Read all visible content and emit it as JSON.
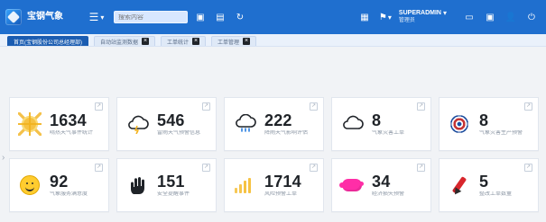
{
  "app": {
    "brand": {
      "title": "宝钢气象",
      "subtitle": ""
    }
  },
  "topbar": {
    "menu_icon": "menu-icon",
    "search": {
      "value": "",
      "placeholder": "搜索内容"
    },
    "user": {
      "name": "SUPERADMIN",
      "role": "管理员"
    }
  },
  "tabs": [
    {
      "label": "首页(宝钢股份公司总经理部)"
    },
    {
      "label": "自动站监测数据"
    },
    {
      "label": "工单统计"
    },
    {
      "label": "工单管理"
    }
  ],
  "cards": [
    {
      "value": "1634",
      "label": "晴热天气事件统计",
      "icon": "sun-icon"
    },
    {
      "value": "546",
      "label": "雷雨天气预警信息",
      "icon": "storm-cloud-icon"
    },
    {
      "value": "222",
      "label": "降雨天气影响评估",
      "icon": "rain-cloud-icon"
    },
    {
      "value": "8",
      "label": "气象灾害工单",
      "icon": "cloud-icon"
    },
    {
      "value": "8",
      "label": "气象灾害生产预警",
      "icon": "target-icon"
    },
    {
      "value": "92",
      "label": "气象服务满意度",
      "icon": "smiley-icon"
    },
    {
      "value": "151",
      "label": "安全提醒事件",
      "icon": "hand-icon"
    },
    {
      "value": "1714",
      "label": "风险预警工单",
      "icon": "bars-icon"
    },
    {
      "value": "34",
      "label": "经济损失预警",
      "icon": "pig-icon"
    },
    {
      "value": "5",
      "label": "整改工单数量",
      "icon": "pen-icon"
    }
  ]
}
